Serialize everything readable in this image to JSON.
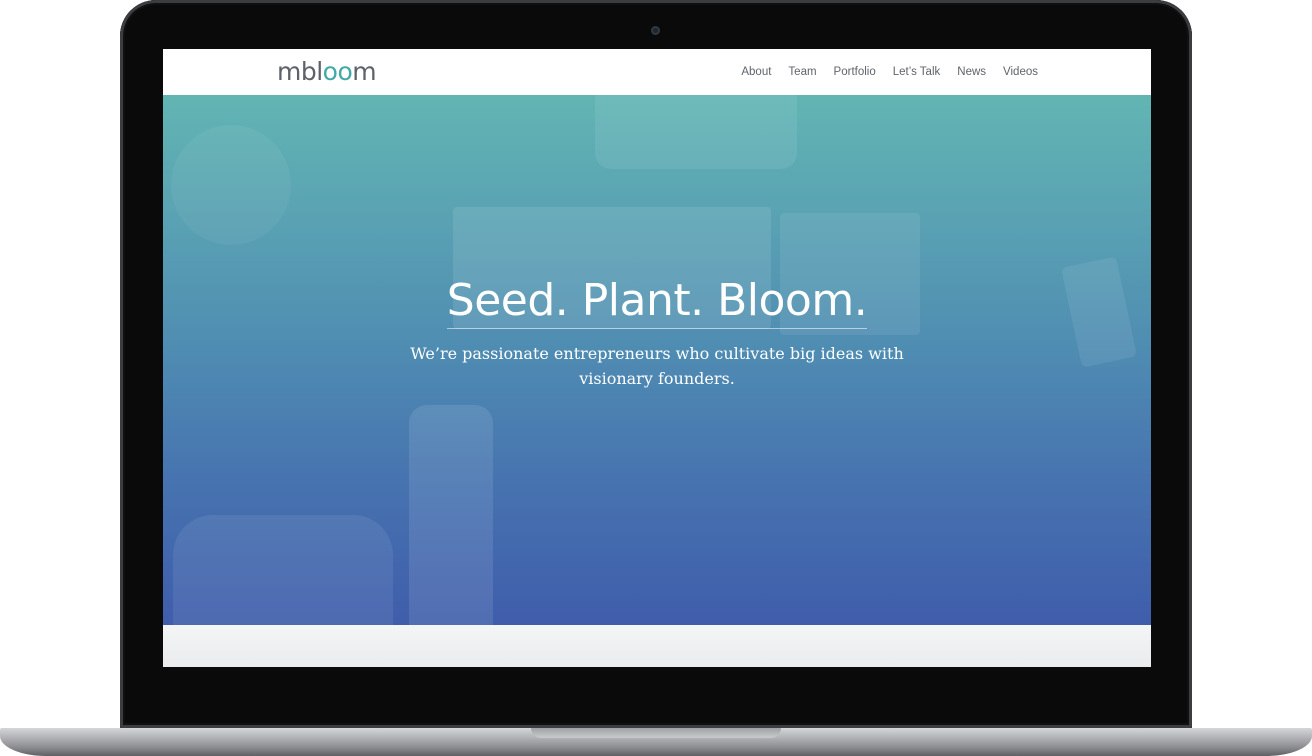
{
  "site": {
    "logo_prefix": "mbl",
    "logo_accent": "oo",
    "logo_suffix": "m"
  },
  "nav": {
    "items": [
      {
        "label": "About"
      },
      {
        "label": "Team"
      },
      {
        "label": "Portfolio"
      },
      {
        "label": "Let’s Talk"
      },
      {
        "label": "News"
      },
      {
        "label": "Videos"
      }
    ]
  },
  "hero": {
    "title": "Seed. Plant. Bloom.",
    "subtitle": "We’re passionate entrepreneurs who cultivate big ideas with visionary founders."
  },
  "colors": {
    "accent_teal": "#43a8a6",
    "hero_top": "#62b5b3",
    "hero_bottom": "#3f5dab",
    "nav_text": "#5f646c"
  }
}
